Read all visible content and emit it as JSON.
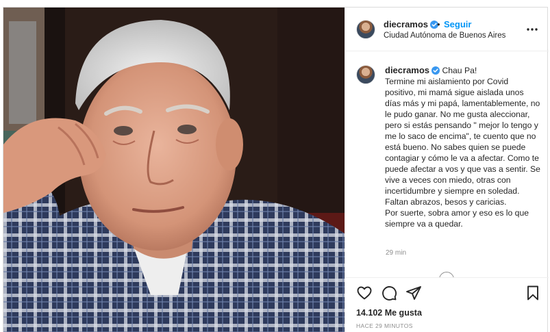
{
  "post": {
    "username": "diecramos",
    "follow_label": "Seguir",
    "separator": "•",
    "location": "Ciudad Autónoma de Buenos Aires",
    "caption_title": "Chau Pa!",
    "caption_body": "Termine mi aislamiento por Covid positivo, mi mamá sigue aislada unos días más y mi papá, lamentablemente, no le pudo ganar. No me gusta aleccionar, pero si estás pensando \" mejor lo tengo y me lo saco de encima\", te cuento que no está bueno. No sabes quien se puede contagiar y cómo le va a afectar. Como te puede afectar a vos y que vas a sentir. Se vive a veces con miedo, otras con incertidumbre y siempre en soledad. Faltan abrazos, besos y caricias.\nPor suerte, sobra amor y eso es lo que siempre va a quedar.",
    "caption_time": "29 min",
    "likes_count": "14.102",
    "likes_label": "Me gusta",
    "posted_ago": "HACE 29 MINUTOS"
  },
  "icons": {
    "verified": "verified-badge-icon",
    "more": "more-options-icon",
    "like": "heart-icon",
    "comment": "comment-icon",
    "share": "share-icon",
    "save": "bookmark-icon"
  },
  "colors": {
    "link_blue": "#0095f6",
    "text": "#262626",
    "muted": "#8e8e8e",
    "border": "#dbdbdb"
  }
}
